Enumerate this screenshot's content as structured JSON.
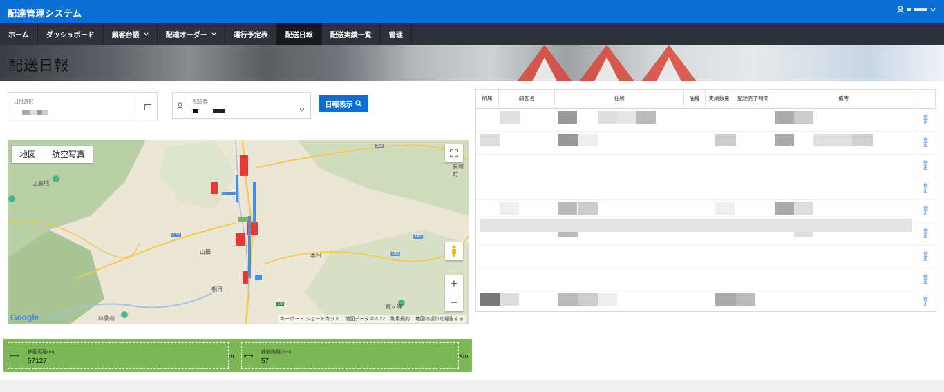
{
  "app": {
    "title": "配達管理システム"
  },
  "nav": {
    "items": [
      {
        "label": "ホーム",
        "dropdown": false,
        "active": false
      },
      {
        "label": "ダッシュボード",
        "dropdown": false,
        "active": false
      },
      {
        "label": "顧客台帳",
        "dropdown": true,
        "active": false
      },
      {
        "label": "配達オーダー",
        "dropdown": true,
        "active": false
      },
      {
        "label": "運行予定表",
        "dropdown": false,
        "active": false
      },
      {
        "label": "配送日報",
        "dropdown": false,
        "active": true
      },
      {
        "label": "配送実績一覧",
        "dropdown": false,
        "active": false
      },
      {
        "label": "管理",
        "dropdown": false,
        "active": false
      }
    ]
  },
  "page": {
    "title": "配送日報"
  },
  "filters": {
    "date_label": "日付選択",
    "staff_label": "配送者",
    "report_button": "日報表示"
  },
  "map": {
    "tab_map": "地図",
    "tab_satellite": "航空写真",
    "labels": [
      "上高地",
      "本州",
      "朝日",
      "霞ヶ峰",
      "林袋山",
      "長和町",
      "山田"
    ],
    "route_numbers": [
      "254",
      "142",
      "158",
      "19",
      "142"
    ],
    "attribution": [
      "キーボード ショートカット",
      "地図データ ©2022",
      "利用規約",
      "地図の誤りを報告する"
    ],
    "google": "Google"
  },
  "stats": [
    {
      "label": "移動距離(m)",
      "value": "57127",
      "unit": "m"
    },
    {
      "label": "移動距離(Km)",
      "value": "57",
      "unit": "Km"
    }
  ],
  "table": {
    "headers": [
      "所属",
      "顧客名",
      "住所",
      "油種",
      "実績数量",
      "配達完了時間",
      "備考",
      ""
    ],
    "edit_label": "修正",
    "row_count": 9
  },
  "colors": {
    "header_blue": "#0b6fd6",
    "nav_dark": "#2d323b",
    "stats_green": "#7cb856",
    "route_red": "#e53935",
    "route_blue": "#4a90e2"
  }
}
